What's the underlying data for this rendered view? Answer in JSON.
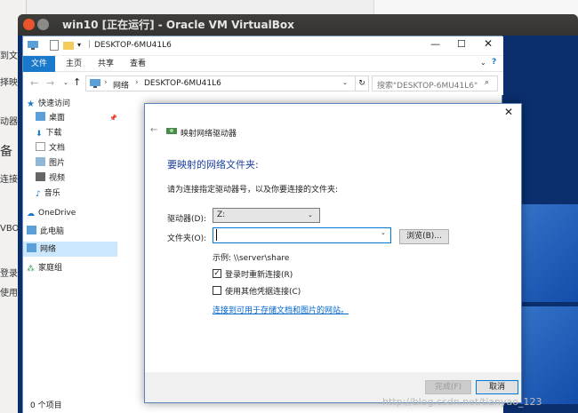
{
  "host": {
    "left_fragments": [
      "到文",
      "择映",
      "动器",
      "备",
      "连接",
      "VBO",
      "登录",
      "使用"
    ]
  },
  "vbox": {
    "title": "win10 [正在运行] - Oracle VM VirtualBox"
  },
  "explorer": {
    "title": "DESKTOP-6MU41L6",
    "ribbon_tabs": [
      "文件",
      "主页",
      "共享",
      "查看"
    ],
    "address_path": [
      "网络",
      "DESKTOP-6MU41L6"
    ],
    "search_placeholder": "搜索\"DESKTOP-6MU41L6\"",
    "nav": {
      "quick_access": "快速访问",
      "items": [
        "桌面",
        "下载",
        "文档",
        "图片",
        "视频",
        "音乐"
      ],
      "onedrive": "OneDrive",
      "this_pc": "此电脑",
      "network": "网络",
      "homegroup": "家庭组"
    },
    "status": "0 个项目"
  },
  "dialog": {
    "title": "映射网络驱动器",
    "heading": "要映射的网络文件夹:",
    "instructions": "请为连接指定驱动器号，以及你要连接的文件夹:",
    "drive_label": "驱动器(D):",
    "drive_value": "Z:",
    "folder_label": "文件夹(O):",
    "folder_value": "",
    "browse_label": "浏览(B)...",
    "example": "示例: \\\\server\\share",
    "reconnect_label": "登录时重新连接(R)",
    "reconnect_checked": true,
    "other_creds_label": "使用其他凭据连接(C)",
    "other_creds_checked": false,
    "link": "连接到可用于存储文档和图片的网站。",
    "finish_label": "完成(F)",
    "cancel_label": "取消"
  },
  "watermark": "http://blog.csdn.net/tianyao_123",
  "colors": {
    "accent": "#1979ca",
    "heading": "#1a3f9e",
    "link": "#0066cc",
    "desktop": "#0b2e6d"
  }
}
